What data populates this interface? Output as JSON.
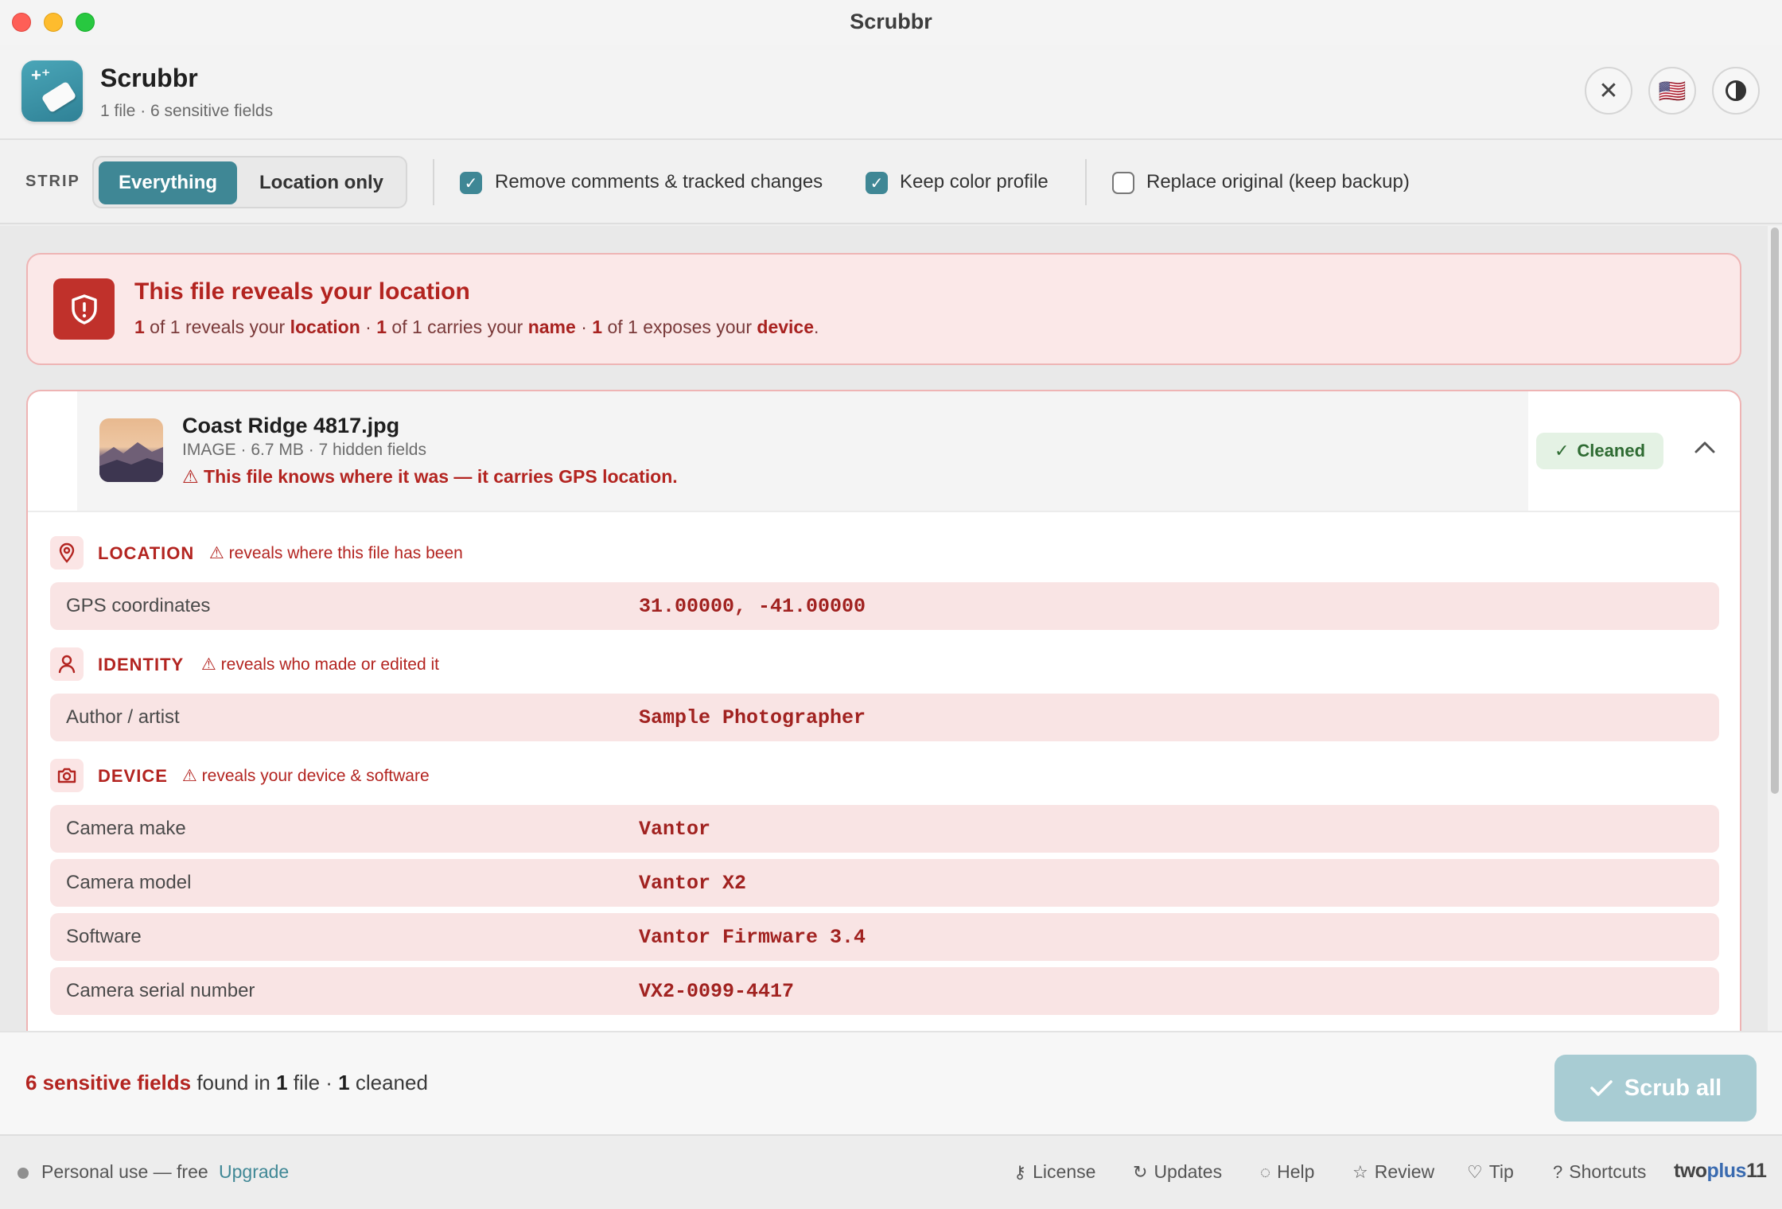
{
  "window": {
    "title": "Scrubbr"
  },
  "header": {
    "app_name": "Scrubbr",
    "subtitle": "1 file · 6 sensitive fields",
    "lang_flag": "🇺🇸"
  },
  "toolbar": {
    "strip_label": "STRIP",
    "modes": [
      "Everything",
      "Location only"
    ],
    "selected_mode": "Everything",
    "options": [
      {
        "label": "Remove comments & tracked changes",
        "checked": true
      },
      {
        "label": "Keep color profile",
        "checked": true
      },
      {
        "label": "Replace original (keep backup)",
        "checked": false
      }
    ]
  },
  "alert": {
    "title": "This file reveals your location",
    "parts": {
      "n1": "1",
      "t1": " of 1 reveals your ",
      "k1": "location",
      "sep1": " · ",
      "n2": "1",
      "t2": " of 1 carries your ",
      "k2": "name",
      "sep2": " · ",
      "n3": "1",
      "t3": " of 1 exposes your ",
      "k3": "device",
      "end": "."
    }
  },
  "file": {
    "name": "Coast Ridge 4817.jpg",
    "meta": "IMAGE · 6.7 MB · 7 hidden fields",
    "warning": "This file knows where it was — it carries GPS location.",
    "status": "Cleaned",
    "sections": [
      {
        "title": "LOCATION",
        "note": "reveals where this file has been",
        "icon": "location-pin-icon",
        "fields": [
          {
            "key": "GPS coordinates",
            "value": "31.00000, -41.00000"
          }
        ]
      },
      {
        "title": "IDENTITY",
        "note": "reveals who made or edited it",
        "icon": "person-icon",
        "fields": [
          {
            "key": "Author / artist",
            "value": "Sample Photographer"
          }
        ]
      },
      {
        "title": "DEVICE",
        "note": "reveals your device & software",
        "icon": "camera-icon",
        "fields": [
          {
            "key": "Camera make",
            "value": "Vantor"
          },
          {
            "key": "Camera model",
            "value": "Vantor X2"
          },
          {
            "key": "Software",
            "value": "Vantor Firmware 3.4"
          },
          {
            "key": "Camera serial number",
            "value": "VX2-0099-4417"
          }
        ]
      }
    ]
  },
  "footer": {
    "summary_hot": "6 sensitive fields",
    "summary_a": " found in ",
    "summary_files": "1",
    "summary_b": " file · ",
    "summary_cleaned": "1",
    "summary_c": " cleaned",
    "scrub_label": "Scrub all"
  },
  "statusbar": {
    "plan": "Personal use — free",
    "upgrade": "Upgrade",
    "links": [
      "License",
      "Updates",
      "Help",
      "Review",
      "Tip",
      "Shortcuts"
    ],
    "brand_a": "two",
    "brand_b": "plus",
    "brand_c": "11"
  },
  "colors": {
    "accent": "#3f8795",
    "danger": "#b32420",
    "danger_bg": "#fbe8e8",
    "success": "#2e6b32"
  }
}
